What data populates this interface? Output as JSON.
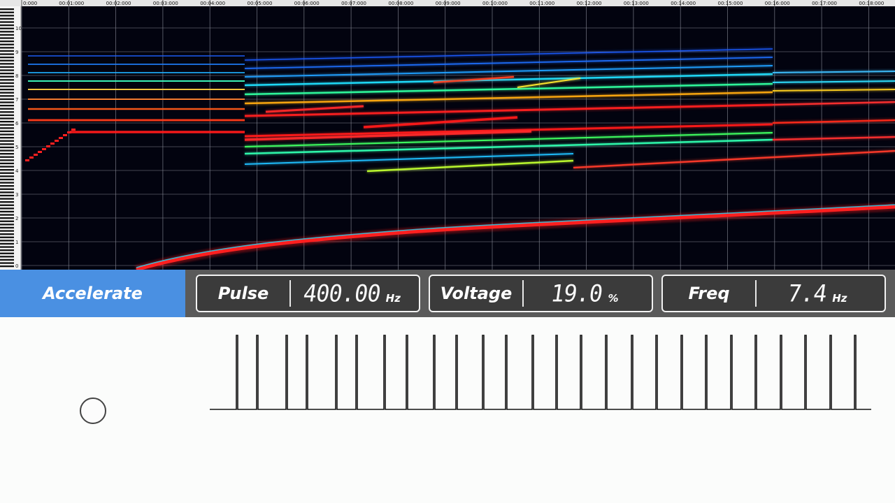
{
  "timeline": {
    "labels": [
      "0:000",
      "00:01:000",
      "00:02:000",
      "00:03:000",
      "00:04:000",
      "00:05:000",
      "00:06:000",
      "00:07:000",
      "00:08:000",
      "00:09:000",
      "00:10:000",
      "00:11:000",
      "00:12:000",
      "00:13:000",
      "00:14:000",
      "00:15:000",
      "00:16:000",
      "00:17:000",
      "00:18:000"
    ]
  },
  "octaves": [
    "10",
    "9",
    "8",
    "7",
    "6",
    "5",
    "4",
    "3",
    "2",
    "1",
    "0"
  ],
  "mode_button": {
    "label": "Accelerate"
  },
  "pulse": {
    "label": "Pulse",
    "value": "400.00",
    "unit": "Hz"
  },
  "voltage": {
    "label": "Voltage",
    "value": "19.0",
    "unit": "%"
  },
  "freq": {
    "label": "Freq",
    "value": "7.4",
    "unit": "Hz"
  },
  "colors": {
    "accent": "#4a90e2",
    "panel": "#3b3b3b",
    "bar": "#5a5a5a",
    "spectrogram_bg": "#02030f"
  },
  "icons": {
    "indicator": "circle-indicator-icon"
  }
}
